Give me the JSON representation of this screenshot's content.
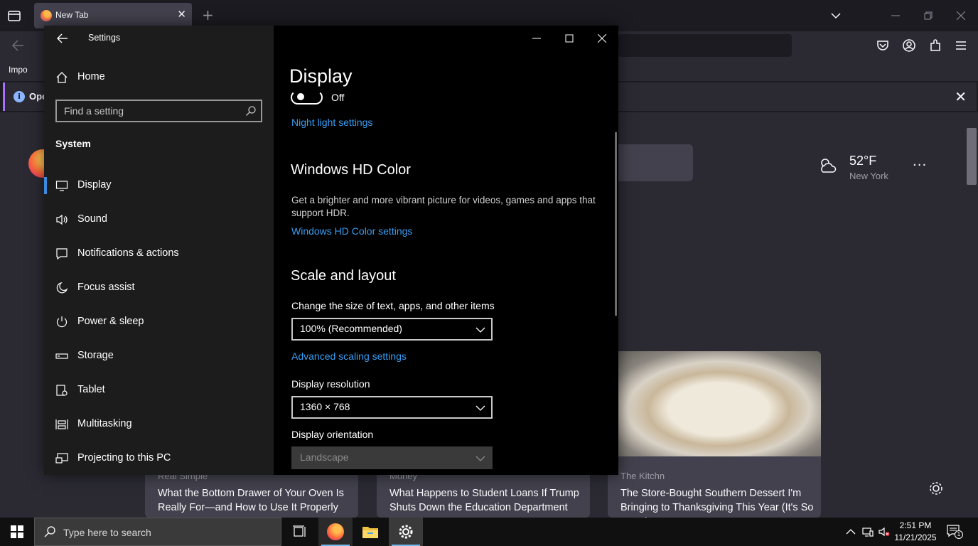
{
  "firefox": {
    "tab_title": "New Tab",
    "tab_close": "✕",
    "new_tab": "+",
    "bookmark_item": "Impo",
    "notice_text": "Ope",
    "notice_close": "✕",
    "weather": {
      "temp": "52°F",
      "city": "New York"
    },
    "more": "···",
    "cards": [
      {
        "source": "Real Simple",
        "headline": "What the Bottom Drawer of Your Oven Is Really For—and How to Use It Properly"
      },
      {
        "source": "Money",
        "headline": "What Happens to Student Loans If Trump Shuts Down the Education Department"
      },
      {
        "source": "The Kitchn",
        "headline": "The Store-Bought Southern Dessert I'm Bringing to Thanksgiving This Year (It's So Cute!)"
      }
    ]
  },
  "settings": {
    "app_title": "Settings",
    "home": "Home",
    "search_placeholder": "Find a setting",
    "section": "System",
    "nav_items": [
      {
        "label": "Display",
        "icon": "monitor-icon",
        "active": true
      },
      {
        "label": "Sound",
        "icon": "speaker-icon"
      },
      {
        "label": "Notifications & actions",
        "icon": "notification-icon"
      },
      {
        "label": "Focus assist",
        "icon": "moon-icon"
      },
      {
        "label": "Power & sleep",
        "icon": "power-icon"
      },
      {
        "label": "Storage",
        "icon": "storage-icon"
      },
      {
        "label": "Tablet",
        "icon": "tablet-icon"
      },
      {
        "label": "Multitasking",
        "icon": "multitasking-icon"
      },
      {
        "label": "Projecting to this PC",
        "icon": "projector-icon"
      }
    ],
    "page_title": "Display",
    "night_light_state": "Off",
    "night_light_link": "Night light settings",
    "hdr": {
      "heading": "Windows HD Color",
      "description": "Get a brighter and more vibrant picture for videos, games and apps that support HDR.",
      "link": "Windows HD Color settings"
    },
    "scale": {
      "heading": "Scale and layout",
      "size_label": "Change the size of text, apps, and other items",
      "size_value": "100% (Recommended)",
      "advanced_link": "Advanced scaling settings",
      "resolution_label": "Display resolution",
      "resolution_value": "1360 × 768",
      "orientation_label": "Display orientation",
      "orientation_value": "Landscape"
    }
  },
  "taskbar": {
    "search_placeholder": "Type here to search",
    "time": "2:51 PM",
    "date": "11/21/2025",
    "notification_count": "1"
  },
  "colors": {
    "accent": "#3a9df2",
    "active_bar": "#3a8be0",
    "firefox_bg": "#2b2a33"
  }
}
